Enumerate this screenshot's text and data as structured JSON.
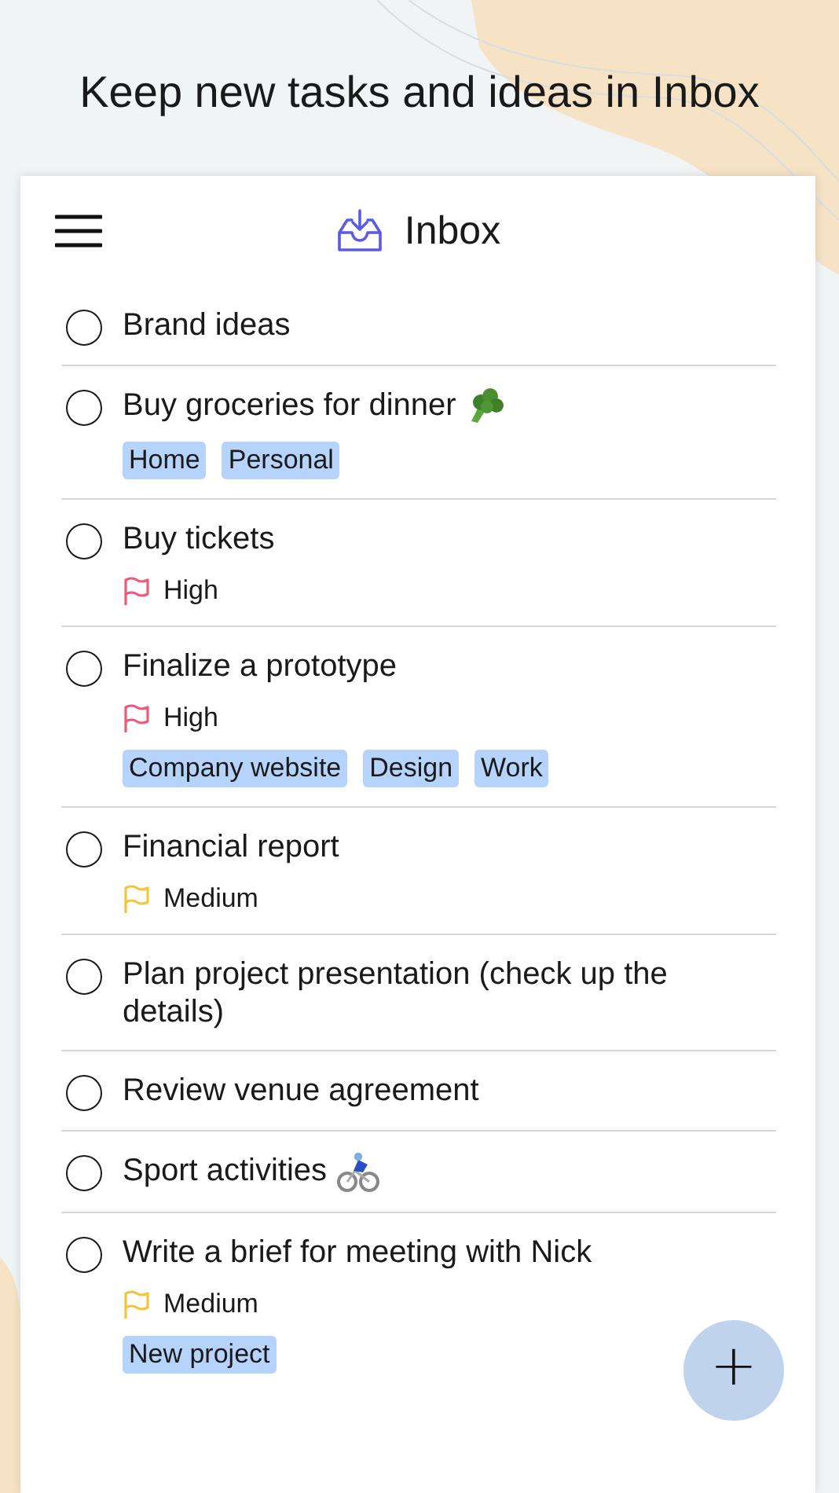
{
  "headline": "Keep new tasks and ideas in Inbox",
  "header": {
    "title": "Inbox"
  },
  "tasks": [
    {
      "title": "Brand ideas",
      "checked": false
    },
    {
      "title": "Buy groceries for dinner",
      "checked": false,
      "emoji": {
        "kind": "broccoli"
      },
      "tags": [
        "Home",
        "Personal"
      ]
    },
    {
      "title": "Buy tickets",
      "checked": false,
      "priority": {
        "label": "High",
        "kind": "high"
      }
    },
    {
      "title": "Finalize a prototype",
      "checked": false,
      "priority": {
        "label": "High",
        "kind": "high"
      },
      "tags": [
        "Company website",
        "Design",
        "Work"
      ]
    },
    {
      "title": "Financial report",
      "checked": false,
      "priority": {
        "label": "Medium",
        "kind": "medium"
      }
    },
    {
      "title": "Plan project presentation (check up the details)",
      "checked": false
    },
    {
      "title": "Review venue agreement",
      "checked": false
    },
    {
      "title": "Sport activities",
      "checked": false,
      "emoji": {
        "kind": "cyclist"
      }
    },
    {
      "title": "Write a brief for meeting with Nick",
      "checked": false,
      "priority": {
        "label": "Medium",
        "kind": "medium"
      },
      "tags": [
        "New project"
      ]
    }
  ],
  "fab": {
    "label": "+"
  }
}
